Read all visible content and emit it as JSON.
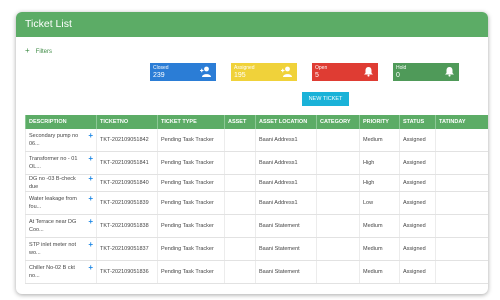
{
  "title": "Ticket List",
  "filters_label": "Filters",
  "tiles": [
    {
      "label": "Closed",
      "value": "239",
      "color": "#2b7dd6",
      "icon": "add-user-icon"
    },
    {
      "label": "Assigned",
      "value": "195",
      "color": "#f0d23a",
      "icon": "add-user-icon"
    },
    {
      "label": "Open",
      "value": "5",
      "color": "#df3c33",
      "icon": "bell-icon"
    },
    {
      "label": "Hold",
      "value": "0",
      "color": "#4f9a59",
      "icon": "bell-icon"
    }
  ],
  "new_ticket_label": "NEW TICKET",
  "table": {
    "headers": [
      "DESCRIPTION",
      "TICKETNO",
      "TICKET TYPE",
      "ASSET",
      "ASSET LOCATION",
      "CATEGORY",
      "PRIORITY",
      "STATUS",
      "TATINDAY"
    ],
    "rows": [
      {
        "desc1": "Secondary pump no",
        "desc2": "06...",
        "ticketno": "TKT-202109051842",
        "type": "Pending Task Tracker",
        "asset": "",
        "location": "Baani Address1",
        "category": "",
        "priority": "Medium",
        "status": "Assigned",
        "tat": ""
      },
      {
        "desc1": "Transformer no - 01",
        "desc2": "OL...",
        "ticketno": "TKT-202109051841",
        "type": "Pending Task Tracker",
        "asset": "",
        "location": "Baani Address1",
        "category": "",
        "priority": "High",
        "status": "Assigned",
        "tat": ""
      },
      {
        "desc1": "DG no -03 B-check due",
        "desc2": "",
        "ticketno": "TKT-202109051840",
        "type": "Pending Task Tracker",
        "asset": "",
        "location": "Baani Address1",
        "category": "",
        "priority": "High",
        "status": "Assigned",
        "tat": ""
      },
      {
        "desc1": "Water leakage from",
        "desc2": "fou...",
        "ticketno": "TKT-202109051839",
        "type": "Pending Task Tracker",
        "asset": "",
        "location": "Baani Address1",
        "category": "",
        "priority": "Low",
        "status": "Assigned",
        "tat": ""
      },
      {
        "desc1": "At Terrace near DG",
        "desc2": "Coo...",
        "ticketno": "TKT-202109051838",
        "type": "Pending Task Tracker",
        "asset": "",
        "location": "Baani Statement",
        "category": "",
        "priority": "Medium",
        "status": "Assigned",
        "tat": ""
      },
      {
        "desc1": "STP inlet meter not",
        "desc2": "wo...",
        "ticketno": "TKT-202109051837",
        "type": "Pending Task Tracker",
        "asset": "",
        "location": "Baani Statement",
        "category": "",
        "priority": "Medium",
        "status": "Assigned",
        "tat": ""
      },
      {
        "desc1": "Chiller No-02 B ckt",
        "desc2": "no...",
        "ticketno": "TKT-202109051836",
        "type": "Pending Task Tracker",
        "asset": "",
        "location": "Baani Statement",
        "category": "",
        "priority": "Medium",
        "status": "Assigned",
        "tat": ""
      }
    ]
  }
}
